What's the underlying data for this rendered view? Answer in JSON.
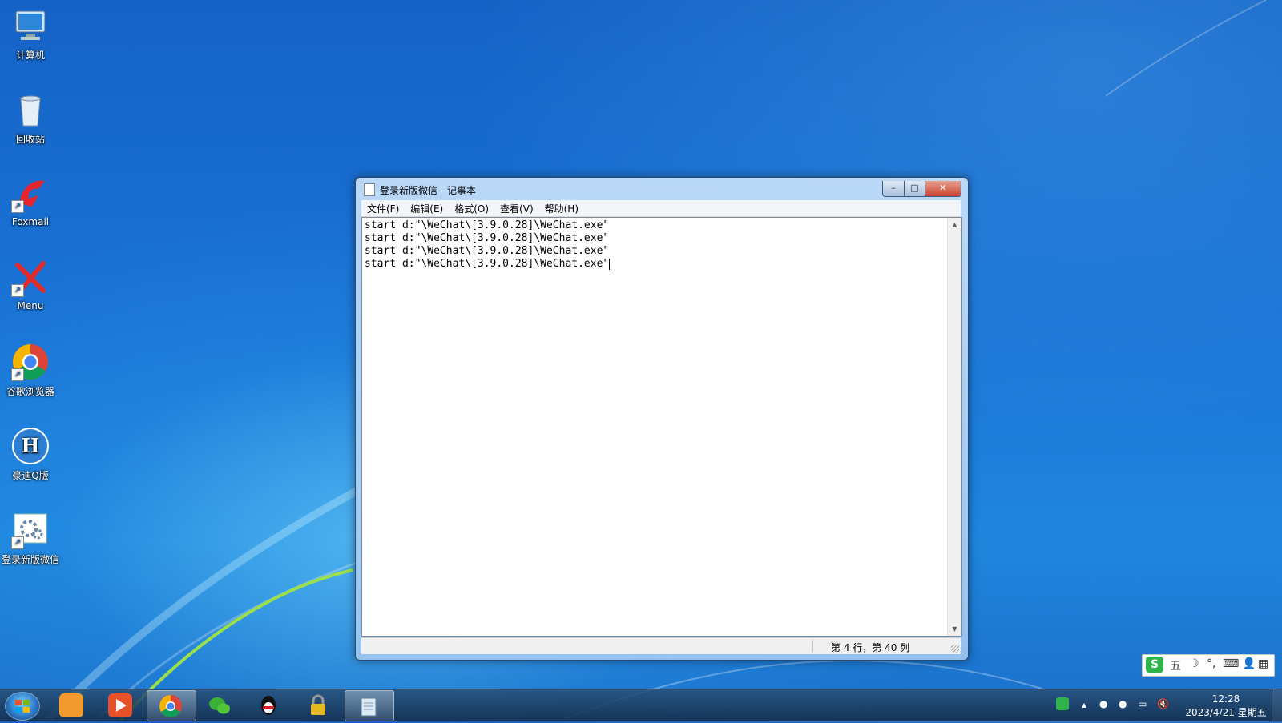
{
  "desktop": {
    "icons": [
      {
        "label": "计算机",
        "icon": "computer-icon"
      },
      {
        "label": "回收站",
        "icon": "recycle-bin-icon"
      },
      {
        "label": "Foxmail",
        "icon": "foxmail-icon"
      },
      {
        "label": "Menu",
        "icon": "menu-x-icon"
      },
      {
        "label": "谷歌浏览器",
        "icon": "chrome-icon"
      },
      {
        "label": "豪迪Q版",
        "icon": "haodi-h-icon"
      },
      {
        "label": "登录新版微信",
        "icon": "settings-shortcut-icon"
      }
    ]
  },
  "notepad": {
    "title": "登录新版微信 - 记事本",
    "controls": {
      "minimize": "–",
      "maximize": "□",
      "close": "✕"
    },
    "menu": [
      "文件(F)",
      "编辑(E)",
      "格式(O)",
      "查看(V)",
      "帮助(H)"
    ],
    "lines": [
      "start d:\"\\WeChat\\[3.9.0.28]\\WeChat.exe\"",
      "start d:\"\\WeChat\\[3.9.0.28]\\WeChat.exe\"",
      "start d:\"\\WeChat\\[3.9.0.28]\\WeChat.exe\"",
      "start d:\"\\WeChat\\[3.9.0.28]\\WeChat.exe\""
    ],
    "status": "第 4 行，第 40 列"
  },
  "ime": {
    "logo": "S",
    "mode": "五",
    "items": [
      "moon-icon",
      "punctuation-icon",
      "keyboard-icon",
      "user-icon",
      "grid-icon"
    ]
  },
  "taskbar": {
    "apps": [
      {
        "name": "uc-browser",
        "color": "#f29a2e"
      },
      {
        "name": "media-player",
        "color": "#e8502a"
      },
      {
        "name": "chrome",
        "color": "#2f9e44",
        "active": true
      },
      {
        "name": "wechat",
        "color": "#3cb034"
      },
      {
        "name": "qq",
        "color": "#111111"
      },
      {
        "name": "lock",
        "color": "#e5b820"
      },
      {
        "name": "notepad",
        "color": "#8fb7d8",
        "active": true
      }
    ],
    "clock": {
      "time": "12:28",
      "date": "2023/4/21 星期五"
    }
  }
}
